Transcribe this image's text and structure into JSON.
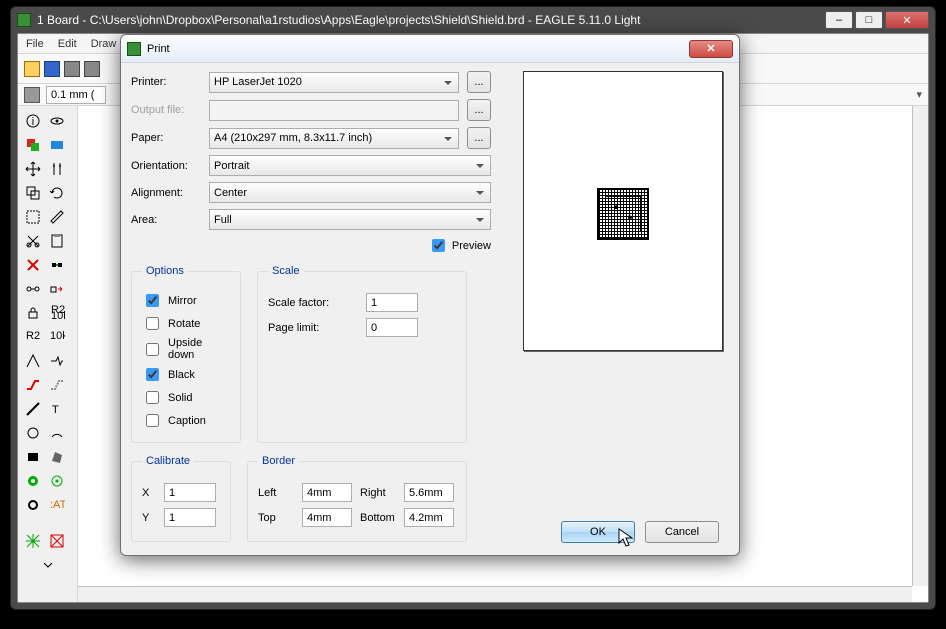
{
  "app": {
    "title": "1 Board - C:\\Users\\john\\Dropbox\\Personal\\a1rstudios\\Apps\\Eagle\\projects\\Shield\\Shield.brd - EAGLE 5.11.0 Light",
    "menus": [
      "File",
      "Edit",
      "Draw"
    ],
    "coord_field": "0.1 mm ("
  },
  "dialog": {
    "title": "Print",
    "labels": {
      "printer": "Printer:",
      "output": "Output file:",
      "paper": "Paper:",
      "orientation": "Orientation:",
      "alignment": "Alignment:",
      "area": "Area:",
      "preview": "Preview",
      "options": "Options",
      "scale": "Scale",
      "scale_factor": "Scale factor:",
      "page_limit": "Page limit:",
      "calibrate": "Calibrate",
      "border": "Border",
      "x": "X",
      "y": "Y",
      "left": "Left",
      "right": "Right",
      "top": "Top",
      "bottom": "Bottom",
      "ok": "OK",
      "cancel": "Cancel",
      "browse": "..."
    },
    "values": {
      "printer": "HP LaserJet 1020",
      "output": "",
      "paper": "A4 (210x297 mm, 8.3x11.7 inch)",
      "orientation": "Portrait",
      "alignment": "Center",
      "area": "Full",
      "preview_checked": true,
      "mirror": true,
      "rotate": false,
      "upside": false,
      "black": true,
      "solid": false,
      "caption": false,
      "opt_mirror": "Mirror",
      "opt_rotate": "Rotate",
      "opt_upside": "Upside down",
      "opt_black": "Black",
      "opt_solid": "Solid",
      "opt_caption": "Caption",
      "scale_factor": "1",
      "page_limit": "0",
      "cal_x": "1",
      "cal_y": "1",
      "b_left": "4mm",
      "b_right": "5.6mm",
      "b_top": "4mm",
      "b_bottom": "4.2mm"
    }
  }
}
